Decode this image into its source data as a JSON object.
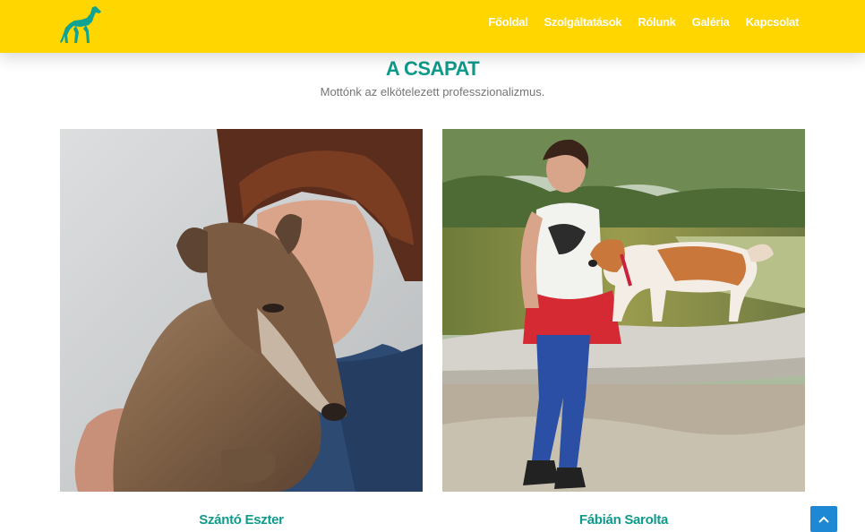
{
  "header": {
    "logo": {
      "icon": "greyhound-logo-icon",
      "color": "#0fa394"
    },
    "nav": [
      {
        "label": "Főoldal"
      },
      {
        "label": "Szolgáltatások"
      },
      {
        "label": "Rólunk"
      },
      {
        "label": "Galéria"
      },
      {
        "label": "Kapcsolat"
      }
    ],
    "background": "#ffd600"
  },
  "team": {
    "title": "A CSAPAT",
    "subtitle": "Mottónk az elkötelezett professzionalizmus.",
    "members": [
      {
        "name": "Szántó Eszter",
        "photo": "woman-holding-greyhound-photo"
      },
      {
        "name": "Fábián Sarolta",
        "photo": "woman-with-dog-on-log-photo"
      }
    ]
  },
  "scroll_top": {
    "icon": "chevron-up-icon"
  },
  "colors": {
    "accent": "#0f9a8c",
    "header": "#ffd600",
    "button": "#1e88d4"
  }
}
